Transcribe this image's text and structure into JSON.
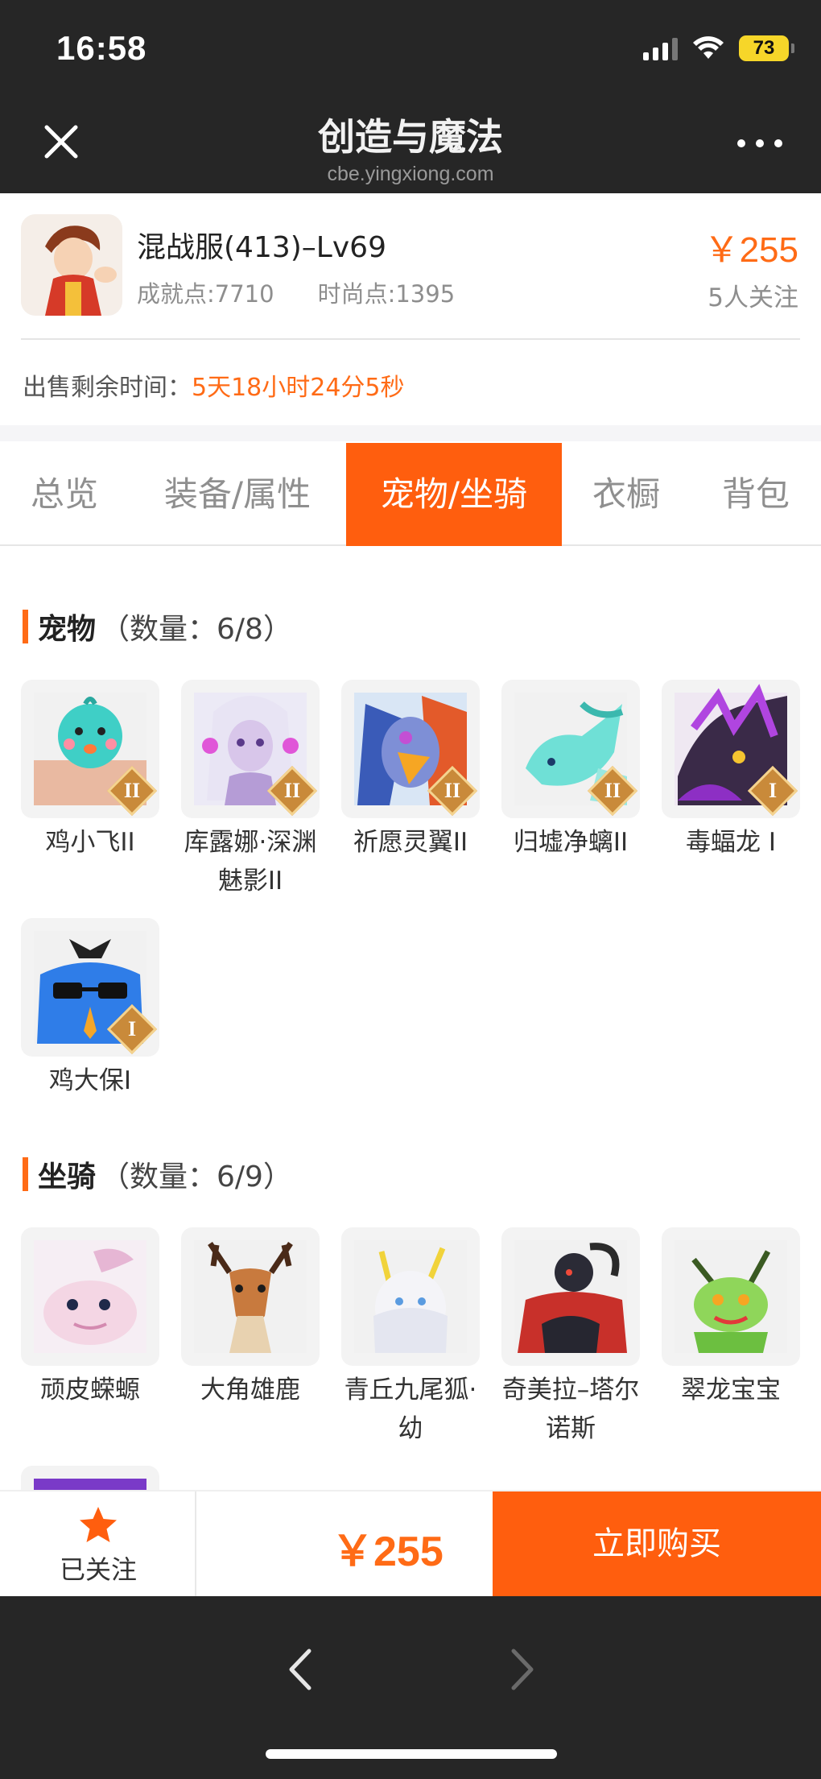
{
  "status_bar": {
    "time": "16:58",
    "battery": "73"
  },
  "title_bar": {
    "title": "创造与魔法",
    "subtitle": "cbe.yingxiong.com"
  },
  "character": {
    "name": "混战服(413)–Lv69",
    "achievement": "成就点:7710",
    "fashion": "时尚点:1395",
    "price": "￥255",
    "followers": "5人关注",
    "sale_label": "出售剩余时间：",
    "sale_time": "5天18小时24分5秒"
  },
  "tabs": [
    {
      "label": "总览",
      "active": false
    },
    {
      "label": "装备/属性",
      "active": false
    },
    {
      "label": "宠物/坐骑",
      "active": true
    },
    {
      "label": "衣橱",
      "active": false
    },
    {
      "label": "背包",
      "active": false
    }
  ],
  "pets": {
    "title": "宠物",
    "count": "（数量：6/8）",
    "items": [
      {
        "name": "鸡小飞II",
        "grade": "II"
      },
      {
        "name": "库露娜·深渊魅影II",
        "grade": "II"
      },
      {
        "name": "祈愿灵翼II",
        "grade": "II"
      },
      {
        "name": "归墟净螭II",
        "grade": "II"
      },
      {
        "name": "毒蝠龙 I",
        "grade": "I"
      },
      {
        "name": "鸡大保I",
        "grade": "I"
      }
    ]
  },
  "mounts": {
    "title": "坐骑",
    "count": "（数量：6/9）",
    "items": [
      {
        "name": "顽皮蝾螈"
      },
      {
        "name": "大角雄鹿"
      },
      {
        "name": "青丘九尾狐·幼"
      },
      {
        "name": "奇美拉–塔尔诺斯"
      },
      {
        "name": "翠龙宝宝"
      }
    ]
  },
  "action_bar": {
    "follow_label": "已关注",
    "price": "￥255",
    "buy_label": "立即购买"
  },
  "colors": {
    "accent": "#ff5e0e",
    "price": "#ff6b16",
    "dark": "#262626"
  }
}
